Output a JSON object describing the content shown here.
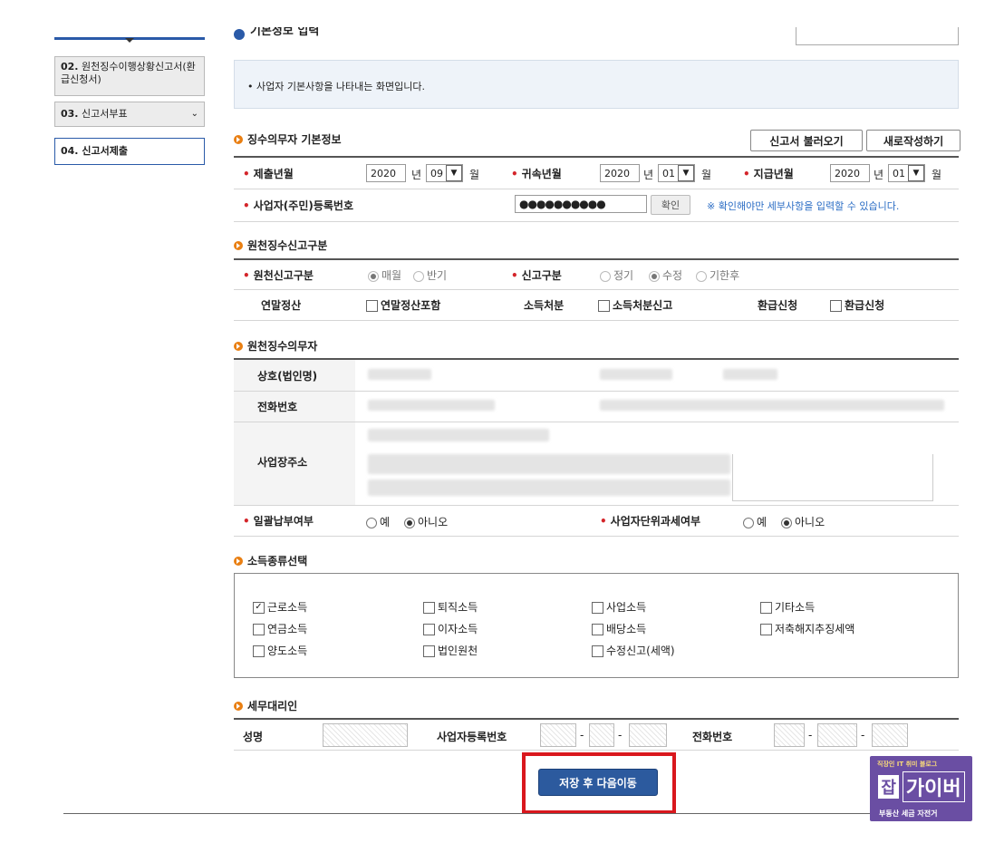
{
  "sidebar": {
    "items": [
      {
        "num": "02.",
        "label": "원천징수이행상황신고서(환급신청서)"
      },
      {
        "num": "03.",
        "label": "신고서부표"
      },
      {
        "num": "04.",
        "label": "신고서제출"
      }
    ]
  },
  "header": {
    "title": "기본정보 입력"
  },
  "info_text": "• 사업자 기본사항을 나타내는 화면입니다.",
  "basic": {
    "title": "징수의무자 기본정보",
    "load_button": "신고서 불러오기",
    "new_button": "새로작성하기",
    "submit_label": "제출년월",
    "submit_year": "2020",
    "submit_month": "09",
    "attr_label": "귀속년월",
    "attr_year": "2020",
    "attr_month": "01",
    "pay_label": "지급년월",
    "pay_year": "2020",
    "pay_month": "01",
    "year_unit": "년",
    "month_unit": "월",
    "reg_label": "사업자(주민)등록번호",
    "reg_value": "●●●●●●●●●●",
    "confirm_button": "확인",
    "reg_note": "※ 확인해야만 세부사항을 입력할 수 있습니다."
  },
  "category": {
    "title": "원천징수신고구분",
    "type_label": "원천신고구분",
    "type_opt1": "매월",
    "type_opt2": "반기",
    "report_label": "신고구분",
    "report_opt1": "정기",
    "report_opt2": "수정",
    "report_opt3": "기한후",
    "yearend_label": "연말정산",
    "yearend_cb": "연말정산포함",
    "income_label": "소득처분",
    "income_cb": "소득처분신고",
    "refund_label": "환급신청",
    "refund_cb": "환급신청"
  },
  "agent": {
    "title": "원천징수의무자",
    "name_label": "상호(법인명)",
    "phone_label": "전화번호",
    "addr_label": "사업장주소",
    "bulk_label": "일괄납부여부",
    "bulk_yes": "예",
    "bulk_no": "아니오",
    "unit_label": "사업자단위과세여부",
    "unit_yes": "예",
    "unit_no": "아니오"
  },
  "income_types": {
    "title": "소득종류선택",
    "items": [
      "근로소득",
      "퇴직소득",
      "사업소득",
      "기타소득",
      "연금소득",
      "이자소득",
      "배당소득",
      "저축해지추징세액",
      "양도소득",
      "법인원천",
      "수정신고(세액)"
    ]
  },
  "tax_agent": {
    "title": "세무대리인",
    "name_label": "성명",
    "bizno_label": "사업자등록번호",
    "phone_label": "전화번호",
    "dash": "-"
  },
  "save_button": "저장 후 다음이동",
  "watermark": {
    "line1": "직장인 IT 취미 블로그",
    "logo_a": "잡",
    "logo_b": "가이버",
    "line3": "부동산 세금 자전거"
  }
}
